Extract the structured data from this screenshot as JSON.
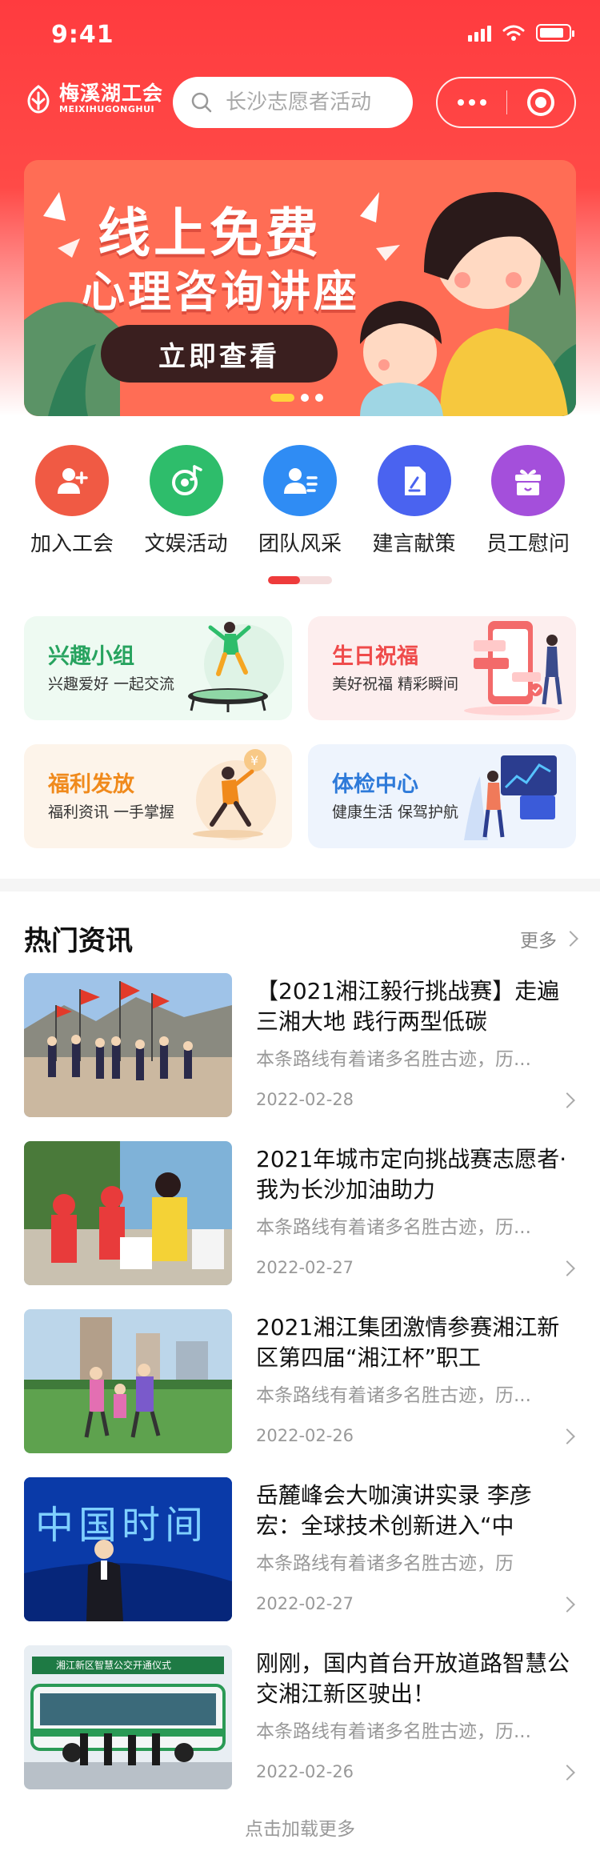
{
  "status_bar": {
    "time": "9:41",
    "battery_level": 0.85
  },
  "header": {
    "logo_cn": "梅溪湖工会",
    "logo_en": "MEIXIHUGONGHUI",
    "search_placeholder": "长沙志愿者活动",
    "more_icon": "more-dots-icon",
    "close_icon": "target-icon"
  },
  "banner": {
    "title": "线上免费",
    "subtitle": "心理咨询讲座",
    "button": "立即查看",
    "slide_count": 3,
    "active_slide": 1
  },
  "quick_nav": [
    {
      "label": "加入工会",
      "icon": "add-user-icon",
      "color": "#f05a44"
    },
    {
      "label": "文娱活动",
      "icon": "music-disc-icon",
      "color": "#2ebd6b"
    },
    {
      "label": "团队风采",
      "icon": "team-icon",
      "color": "#2f8cf4"
    },
    {
      "label": "建言献策",
      "icon": "document-edit-icon",
      "color": "#4a63f0"
    },
    {
      "label": "员工慰问",
      "icon": "gift-icon",
      "color": "#a44fdb"
    }
  ],
  "features": [
    {
      "title": "兴趣小组",
      "desc": "兴趣爱好 一起交流",
      "title_color": "#27a35f",
      "bg": "#eefaf2"
    },
    {
      "title": "生日祝福",
      "desc": "美好祝福 精彩瞬间",
      "title_color": "#ef4b4b",
      "bg": "#fdeeee"
    },
    {
      "title": "福利发放",
      "desc": "福利资讯 一手掌握",
      "title_color": "#f08a1c",
      "bg": "#fdf4ea"
    },
    {
      "title": "体检中心",
      "desc": "健康生活 保驾护航",
      "title_color": "#2e7ad9",
      "bg": "#eef4fd"
    }
  ],
  "news": {
    "section_title": "热门资讯",
    "more_label": "更多",
    "items": [
      {
        "headline": "【2021湘江毅行挑战赛】走遍三湘大地 践行两型低碳",
        "summary": "本条路线有着诸多名胜古迹，历...",
        "date": "2022-02-28"
      },
      {
        "headline": "2021年城市定向挑战赛志愿者·我为长沙加油助力",
        "summary": "本条路线有着诸多名胜古迹，历...",
        "date": "2022-02-27"
      },
      {
        "headline": "2021湘江集团激情参赛湘江新区第四届“湘江杯”职工",
        "summary": "本条路线有着诸多名胜古迹，历...",
        "date": "2022-02-26"
      },
      {
        "headline": "岳麓峰会大咖演讲实录 李彦宏：全球技术创新进入“中",
        "summary": "本条路线有着诸多名胜古迹，历",
        "date": "2022-02-27"
      },
      {
        "headline": "刚刚，国内首台开放道路智慧公交湘江新区驶出！",
        "summary": "本条路线有着诸多名胜古迹，历...",
        "date": "2022-02-26"
      }
    ],
    "thumb_texts": {
      "item4": "中国时间",
      "item5": "湘江新区智慧公交开通仪式"
    }
  },
  "load_more": "点击加载更多"
}
